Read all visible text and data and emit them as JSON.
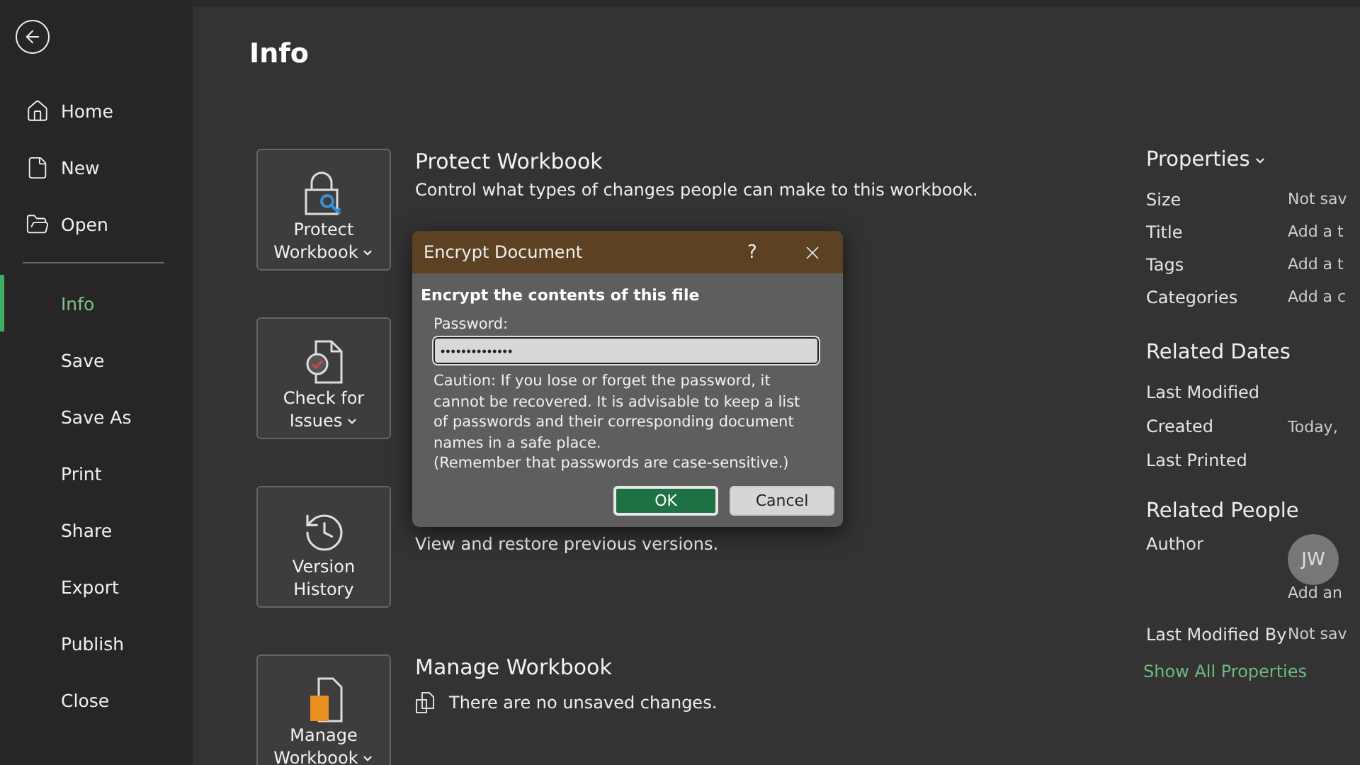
{
  "sidebar": {
    "top_items": [
      {
        "label": "Home"
      },
      {
        "label": "New"
      },
      {
        "label": "Open"
      }
    ],
    "items": [
      {
        "label": "Info",
        "selected": true
      },
      {
        "label": "Save",
        "selected": false
      },
      {
        "label": "Save As",
        "selected": false
      },
      {
        "label": "Print",
        "selected": false
      },
      {
        "label": "Share",
        "selected": false
      },
      {
        "label": "Export",
        "selected": false
      },
      {
        "label": "Publish",
        "selected": false
      },
      {
        "label": "Close",
        "selected": false
      }
    ]
  },
  "page_title": "Info",
  "sections": [
    {
      "kind": "protect",
      "button": [
        "Protect",
        "Workbook"
      ],
      "dropdown": true,
      "title": "Protect Workbook",
      "description": "Control what types of changes people can make to this workbook."
    },
    {
      "kind": "check",
      "button": [
        "Check for",
        "Issues"
      ],
      "dropdown": true
    },
    {
      "kind": "history",
      "button": [
        "Version",
        "History"
      ],
      "dropdown": false,
      "description": "View and restore previous versions."
    },
    {
      "kind": "manage",
      "button": [
        "Manage",
        "Workbook"
      ],
      "dropdown": true,
      "title": "Manage Workbook",
      "status": "There are no unsaved changes."
    }
  ],
  "properties": {
    "title": "Properties",
    "rows": [
      {
        "label": "Size",
        "value": "Not sav"
      },
      {
        "label": "Title",
        "value": "Add a t"
      },
      {
        "label": "Tags",
        "value": "Add a t"
      },
      {
        "label": "Categories",
        "value": "Add a c"
      }
    ]
  },
  "related_dates": {
    "title": "Related Dates",
    "rows": [
      {
        "label": "Last Modified"
      },
      {
        "label": "Created",
        "value": "Today,"
      },
      {
        "label": "Last Printed"
      }
    ]
  },
  "related_people": {
    "title": "Related People",
    "author_label": "Author",
    "author_initials": "JW",
    "add_author": "Add an",
    "last_modified_by_label": "Last Modified By",
    "last_modified_by": "Not sav",
    "show_all": "Show All Properties"
  },
  "dialog": {
    "title": "Encrypt Document",
    "help": "?",
    "heading": "Encrypt the contents of this file",
    "field_label": "Password:",
    "password": "••••••••••••••",
    "caution": "Caution: If you lose or forget the password, it cannot be recovered. It is advisable to keep a list of passwords and their corresponding document names in a safe place.",
    "reminder": "(Remember that passwords are case-sensitive.)",
    "ok": "OK",
    "cancel": "Cancel"
  }
}
